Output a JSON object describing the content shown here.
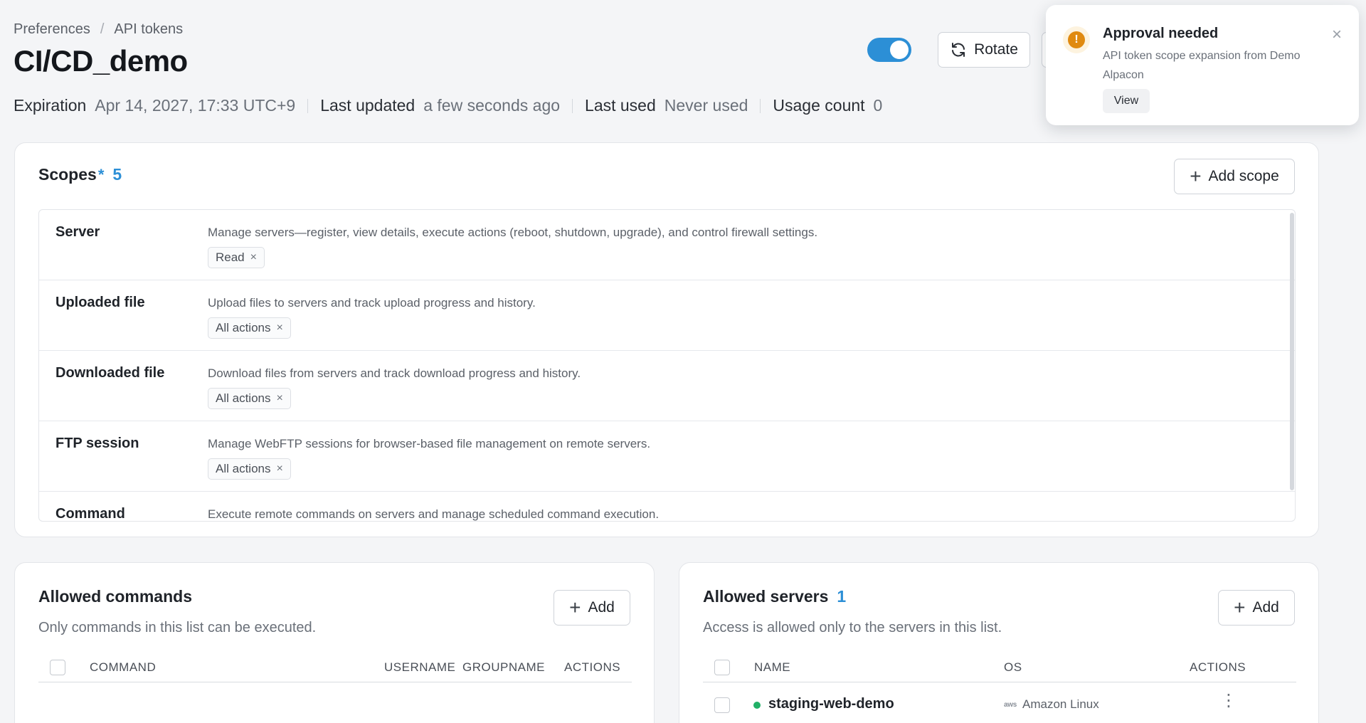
{
  "breadcrumb": {
    "parent": "Preferences",
    "separator": "/",
    "current": "API tokens"
  },
  "token": {
    "title": "CI/CD_demo",
    "enabled": true,
    "expiration_label": "Expiration",
    "expiration_value": "Apr 14, 2027, 17:33 UTC+9",
    "last_updated_label": "Last updated",
    "last_updated_value": "a few seconds ago",
    "last_used_label": "Last used",
    "last_used_value": "Never used",
    "usage_count_label": "Usage count",
    "usage_count_value": "0"
  },
  "actions": {
    "rotate_label": "Rotate"
  },
  "toast": {
    "title": "Approval needed",
    "body": "API token scope expansion from Demo Alpacon",
    "view_label": "View",
    "close_icon": "×",
    "icon": "!"
  },
  "scopes": {
    "title": "Scopes",
    "required_mark": "*",
    "count": "5",
    "add_label": "Add scope",
    "items": [
      {
        "name": "Server",
        "description": "Manage servers—register, view details, execute actions (reboot, shutdown, upgrade), and control firewall settings.",
        "permission": "Read"
      },
      {
        "name": "Uploaded file",
        "description": "Upload files to servers and track upload progress and history.",
        "permission": "All actions"
      },
      {
        "name": "Downloaded file",
        "description": "Download files from servers and track download progress and history.",
        "permission": "All actions"
      },
      {
        "name": "FTP session",
        "description": "Manage WebFTP sessions for browser-based file management on remote servers.",
        "permission": "All actions"
      },
      {
        "name": "Command",
        "description": "Execute remote commands on servers and manage scheduled command execution.",
        "permission": ""
      }
    ]
  },
  "allowed_commands": {
    "title": "Allowed commands",
    "description": "Only commands in this list can be executed.",
    "add_label": "Add",
    "columns": [
      "COMMAND",
      "USERNAME",
      "GROUPNAME",
      "ACTIONS"
    ],
    "rows": []
  },
  "allowed_servers": {
    "title": "Allowed servers",
    "count": "1",
    "description": "Access is allowed only to the servers in this list.",
    "add_label": "Add",
    "columns": [
      "NAME",
      "OS",
      "ACTIONS"
    ],
    "rows": [
      {
        "name": "staging-web-demo",
        "os": "Amazon Linux",
        "os_icon": "aws",
        "status_color": "#22b067"
      }
    ]
  },
  "colors": {
    "accent": "#2c8fd6",
    "warning": "#e08a10",
    "online": "#22b067"
  },
  "icons": {
    "rotate": "rotate-icon",
    "plus": "+",
    "remove": "×",
    "more": "⋮"
  }
}
